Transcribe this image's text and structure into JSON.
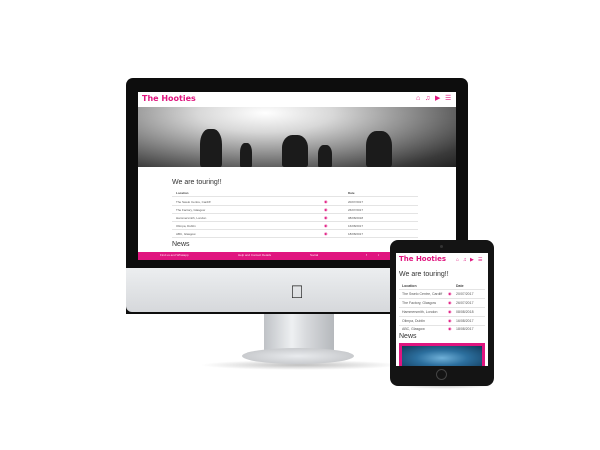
{
  "site": {
    "brand": "The Hooties",
    "nav_icons": [
      "home-icon",
      "music-icon",
      "video-icon",
      "menu-icon"
    ],
    "touring_title": "We are touring!!",
    "table_headers": {
      "location": "Location",
      "date": "Date"
    },
    "tour_rows": [
      {
        "location": "The Swelo Centre, Cardiff",
        "date": "20/07/2017"
      },
      {
        "location": "The Factory, Glasgow",
        "date": "26/07/2017"
      },
      {
        "location": "Hammersmith, London",
        "date": "08/08/2018"
      },
      {
        "location": "Olimpa, Dublin",
        "date": "16/08/2017"
      },
      {
        "location": "ABC, Glasgow",
        "date": "18/08/2017"
      }
    ],
    "news_title": "News",
    "footer": {
      "left": "Find us and Whatapp",
      "middle": "Help and Contact Details",
      "right": "Social"
    },
    "accent": "#e0157f"
  }
}
